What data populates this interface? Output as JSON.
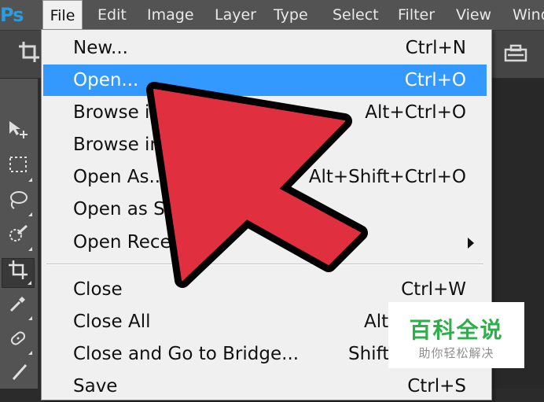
{
  "app": {
    "logo": "Ps"
  },
  "menubar": {
    "items": [
      "File",
      "Edit",
      "Image",
      "Layer",
      "Type",
      "Select",
      "Filter",
      "View",
      "Wind"
    ]
  },
  "optionsbar": {
    "left_icon": "crop-icon",
    "right_icon": "camera-straighten-icon"
  },
  "tools": [
    {
      "icon": "move-tool-icon"
    },
    {
      "icon": "marquee-tool-icon"
    },
    {
      "icon": "lasso-tool-icon"
    },
    {
      "icon": "quick-selection-tool-icon"
    },
    {
      "icon": "crop-tool-icon",
      "selected": true
    },
    {
      "icon": "eyedropper-tool-icon"
    },
    {
      "icon": "healing-brush-tool-icon"
    },
    {
      "icon": "brush-tool-icon"
    }
  ],
  "file_menu": {
    "items": [
      {
        "label": "New...",
        "shortcut": "Ctrl+N"
      },
      {
        "label": "Open...",
        "shortcut": "Ctrl+O",
        "highlighted": true
      },
      {
        "label": "Browse in",
        "shortcut": "Alt+Ctrl+O"
      },
      {
        "label": "Browse in Mi",
        "shortcut": ""
      },
      {
        "label": "Open As...",
        "shortcut": "Alt+Shift+Ctrl+O"
      },
      {
        "label": "Open as Smart Object...",
        "shortcut": ""
      },
      {
        "label": "Open Recent",
        "shortcut": "",
        "submenu": true
      },
      {
        "label": "Close",
        "shortcut": "Ctrl+W"
      },
      {
        "label": "Close All",
        "shortcut": "Alt+Ctrl+W"
      },
      {
        "label": "Close and Go to Bridge...",
        "shortcut": "Shift+Ctrl+W"
      },
      {
        "label": "Save",
        "shortcut": "Ctrl+S"
      }
    ]
  },
  "annotation": {
    "arrow_color": "#e03040",
    "outline_color": "#000000"
  },
  "watermark": {
    "title": "百科全说",
    "subtitle": "助你轻松解决"
  },
  "colors": {
    "highlight": "#3399ff",
    "menu_bg": "#f0f0f0",
    "ps_blue": "#2f9bd8",
    "watermark_green": "#2db04a"
  }
}
